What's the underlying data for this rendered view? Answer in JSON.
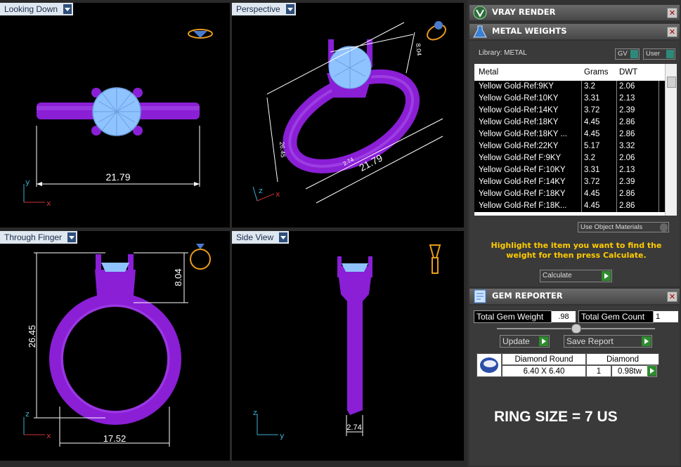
{
  "viewports": {
    "looking_down": {
      "title": "Looking Down",
      "dim_width": "21.79",
      "axis_v": "y",
      "axis_h": "x"
    },
    "perspective": {
      "title": "Perspective",
      "dim_width": "21.79",
      "dim_height": "26.45",
      "dim_top": "8.04",
      "dim_small": "2.74",
      "axis_v": "z",
      "axis_h": "x"
    },
    "through_finger": {
      "title": "Through Finger",
      "dim_height": "26.45",
      "dim_top": "8.04",
      "dim_width": "17.52",
      "axis_v": "z",
      "axis_h": "x"
    },
    "side_view": {
      "title": "Side View",
      "dim_width": "2.74",
      "axis_v": "z",
      "axis_h": "y"
    }
  },
  "vray": {
    "title": "VRAY RENDER"
  },
  "metal_weights": {
    "title": "METAL WEIGHTS",
    "library_label": "Library: METAL",
    "toggle_gv": "GV",
    "toggle_user": "User",
    "columns": [
      "Metal",
      "Grams",
      "DWT"
    ],
    "rows": [
      {
        "metal": "Yellow Gold-Ref:9KY",
        "grams": "3.2",
        "dwt": "2.06"
      },
      {
        "metal": "Yellow Gold-Ref:10KY",
        "grams": "3.31",
        "dwt": "2.13"
      },
      {
        "metal": "Yellow Gold-Ref:14KY",
        "grams": "3.72",
        "dwt": "2.39"
      },
      {
        "metal": "Yellow Gold-Ref:18KY",
        "grams": "4.45",
        "dwt": "2.86"
      },
      {
        "metal": "Yellow Gold-Ref:18KY ...",
        "grams": "4.45",
        "dwt": "2.86"
      },
      {
        "metal": "Yellow Gold-Ref:22KY",
        "grams": "5.17",
        "dwt": "3.32"
      },
      {
        "metal": "Yellow Gold-Ref F:9KY",
        "grams": "3.2",
        "dwt": "2.06"
      },
      {
        "metal": "Yellow Gold-Ref F:10KY",
        "grams": "3.31",
        "dwt": "2.13"
      },
      {
        "metal": "Yellow Gold-Ref F:14KY",
        "grams": "3.72",
        "dwt": "2.39"
      },
      {
        "metal": "Yellow Gold-Ref F:18KY",
        "grams": "4.45",
        "dwt": "2.86"
      },
      {
        "metal": "Yellow Gold-Ref F:18K...",
        "grams": "4.45",
        "dwt": "2.86"
      }
    ],
    "use_object_materials": "Use Object Materials",
    "hint": "Highlight the item you want to find the weight for then press Calculate.",
    "calculate_label": "Calculate"
  },
  "gem_reporter": {
    "title": "GEM REPORTER",
    "total_weight_label": "Total Gem Weight",
    "total_weight_value": ".98",
    "total_count_label": "Total Gem Count",
    "total_count_value": "1",
    "update_label": "Update",
    "save_report_label": "Save Report",
    "gem": {
      "name": "Diamond Round",
      "size": "6.40 X 6.40",
      "material": "Diamond",
      "count": "1",
      "weight": "0.98tw"
    }
  },
  "ring_size": "RING SIZE = 7 US",
  "colors": {
    "ring": "#8a1fd6",
    "gem": "#8fc3ff",
    "hint": "#ffcc00",
    "dim": "#ffffff"
  }
}
